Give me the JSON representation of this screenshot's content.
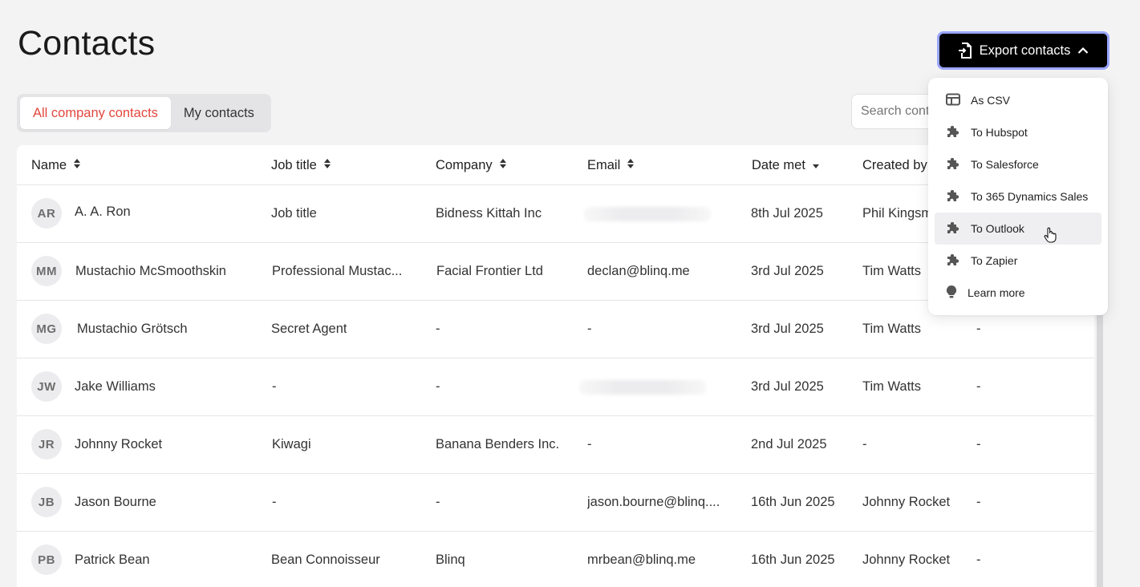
{
  "page": {
    "title": "Contacts"
  },
  "export": {
    "label": "Export contacts"
  },
  "tabs": [
    {
      "label": "All company contacts",
      "active": true
    },
    {
      "label": "My contacts",
      "active": false
    }
  ],
  "search": {
    "placeholder": "Search contacts"
  },
  "columns": [
    "Name",
    "Job title",
    "Company",
    "Email",
    "Date met",
    "Created by"
  ],
  "rows": [
    {
      "initials": "AR",
      "name": "A. A. Ron",
      "job": "Job title",
      "company": "Bidness Kittah Inc",
      "email": "",
      "date": "8th Jul 2025",
      "created": "Phil Kingsm",
      "extra": ""
    },
    {
      "initials": "MM",
      "name": "Mustachio McSmoothskin",
      "job": "Professional Mustac...",
      "company": "Facial Frontier Ltd",
      "email": "declan@blinq.me",
      "date": "3rd Jul 2025",
      "created": "Tim Watts",
      "extra": ""
    },
    {
      "initials": "MG",
      "name": "Mustachio Grötsch",
      "job": "Secret Agent",
      "company": "-",
      "email": "-",
      "date": "3rd Jul 2025",
      "created": "Tim Watts",
      "extra": "-"
    },
    {
      "initials": "JW",
      "name": "Jake Williams",
      "job": "-",
      "company": "-",
      "email": "",
      "date": "3rd Jul 2025",
      "created": "Tim Watts",
      "extra": "-"
    },
    {
      "initials": "JR",
      "name": "Johnny Rocket",
      "job": "Kiwagi",
      "company": "Banana Benders Inc.",
      "email": "-",
      "date": "2nd Jul 2025",
      "created": "-",
      "extra": "-"
    },
    {
      "initials": "JB",
      "name": "Jason Bourne",
      "job": "-",
      "company": "-",
      "email": "jason.bourne@blinq....",
      "date": "16th Jun 2025",
      "created": "Johnny Rocket",
      "extra": "-"
    },
    {
      "initials": "PB",
      "name": "Patrick Bean",
      "job": "Bean Connoisseur",
      "company": "Blinq",
      "email": "mrbean@blinq.me",
      "date": "16th Jun 2025",
      "created": "Johnny Rocket",
      "extra": "-"
    }
  ],
  "menu": [
    {
      "label": "As CSV",
      "icon": "table-icon"
    },
    {
      "label": "To Hubspot",
      "icon": "puzzle-icon"
    },
    {
      "label": "To Salesforce",
      "icon": "puzzle-icon"
    },
    {
      "label": "To 365 Dynamics Sales",
      "icon": "puzzle-icon"
    },
    {
      "label": "To Outlook",
      "icon": "puzzle-icon",
      "hovered": true
    },
    {
      "label": "To Zapier",
      "icon": "puzzle-icon"
    },
    {
      "label": "Learn more",
      "icon": "lightbulb-icon"
    }
  ],
  "colors": {
    "accent": "#e2483d",
    "button": "#000000",
    "focus_ring": "#9aa6ff"
  }
}
